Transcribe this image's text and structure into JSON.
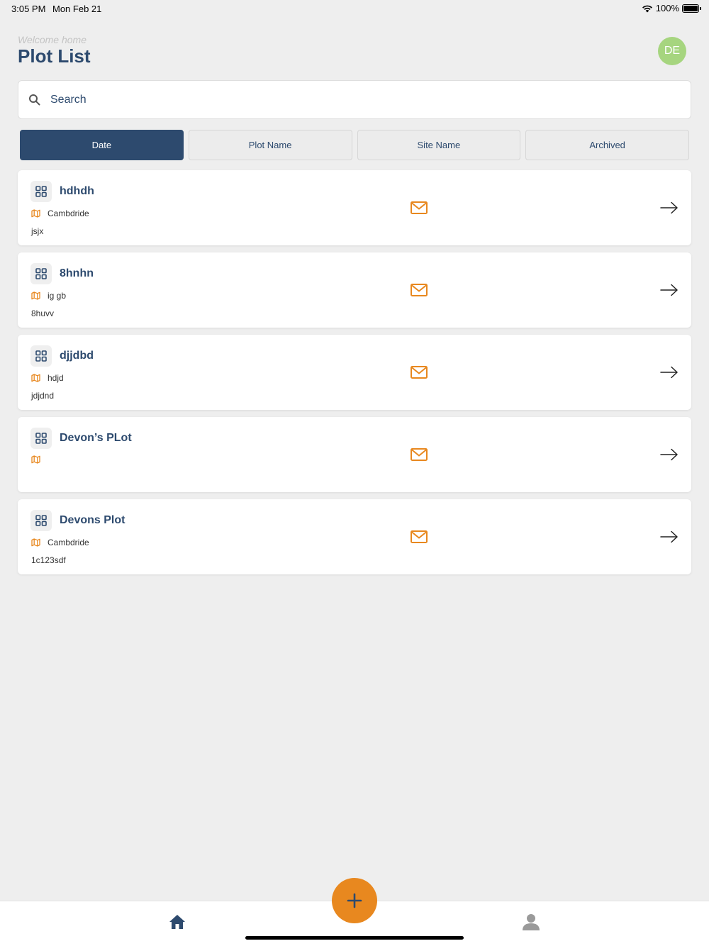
{
  "status": {
    "time": "3:05 PM",
    "date": "Mon Feb 21",
    "battery": "100%"
  },
  "header": {
    "welcome": "Welcome home",
    "title": "Plot List",
    "avatar_initials": "DE"
  },
  "search": {
    "placeholder": "Search"
  },
  "tabs": [
    {
      "label": "Date",
      "active": true
    },
    {
      "label": "Plot Name",
      "active": false
    },
    {
      "label": "Site Name",
      "active": false
    },
    {
      "label": "Archived",
      "active": false
    }
  ],
  "plots": [
    {
      "name": "hdhdh",
      "site": "Cambdride",
      "ref": "jsjx"
    },
    {
      "name": "8hnhn",
      "site": "ig gb",
      "ref": "8huvv"
    },
    {
      "name": "djjdbd",
      "site": "hdjd",
      "ref": "jdjdnd"
    },
    {
      "name": "Devon’s PLot",
      "site": "",
      "ref": ""
    },
    {
      "name": "Devons Plot",
      "site": "Cambdride",
      "ref": "1c123sdf"
    }
  ],
  "colors": {
    "primary": "#2d4a6e",
    "accent": "#e8881f",
    "avatar": "#a6d57f",
    "background": "#eeeeee"
  },
  "icons": {
    "search": "search-icon",
    "grid": "grid-icon",
    "map": "map-icon",
    "mail": "mail-icon",
    "arrow": "arrow-right-icon",
    "home": "home-icon",
    "profile": "user-icon",
    "add": "plus-icon"
  }
}
